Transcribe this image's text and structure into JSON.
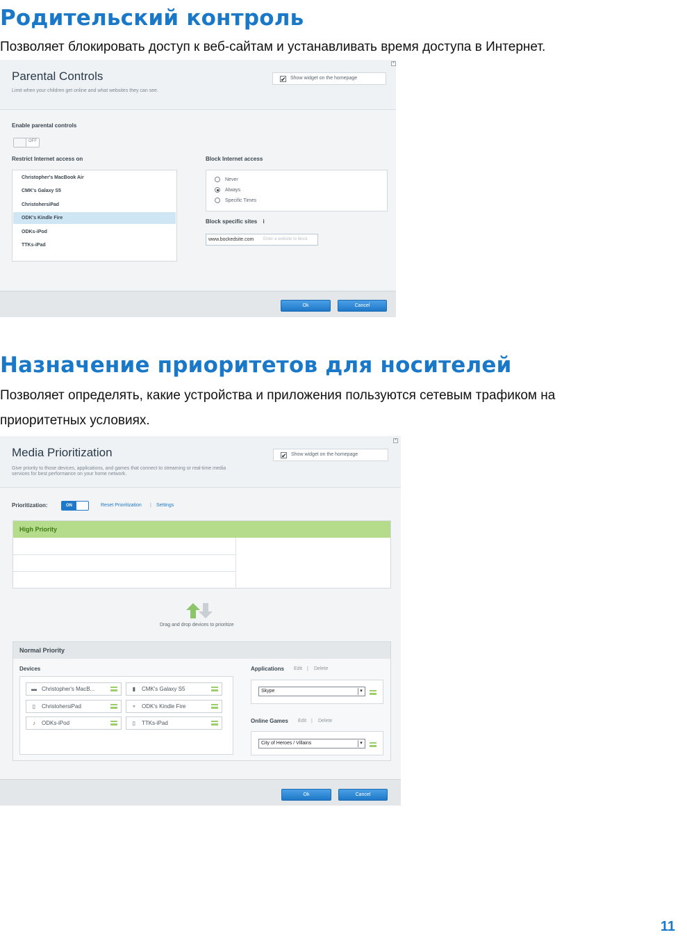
{
  "section1": {
    "heading": "Родительский контроль",
    "description": "Позволяет блокировать доступ к веб-сайтам и устанавливать время доступа в Интернет."
  },
  "parental": {
    "title": "Parental Controls",
    "subtitle": "Limit when your children get online and what websites they can see.",
    "close": "×",
    "widget_label": "Show widget on the homepage",
    "widget_checkmark": "✔",
    "enable_label": "Enable parental controls",
    "toggle_state": "OFF",
    "restrict_label": "Restrict Internet access on",
    "devices": [
      "Christopher's MacBook Air",
      "CMK's Galaxy S5",
      "ChristohersiPad",
      "ODK's Kindle Fire",
      "ODKs-iPod",
      "TTKs-iPad"
    ],
    "selected_device_index": 3,
    "block_label": "Block Internet access",
    "block_options": [
      "Never",
      "Always",
      "Specific Times"
    ],
    "block_selected": "Always",
    "sites_label": "Block specific sites",
    "sites_info": "i",
    "site_value": "www.bockedsite.com",
    "site_placeholder": "Enter a website to block",
    "ok_label": "Ok",
    "cancel_label": "Cancel"
  },
  "section2": {
    "heading": "Назначение приоритетов для носителей",
    "description_line1": "Позволяет определять, какие устройства и приложения пользуются сетевым трафиком на",
    "description_line2": "приоритетных условиях."
  },
  "media": {
    "title": "Media Prioritization",
    "subtitle_line1": "Give priority to those devices, applications, and games that connect to streaming or real-time media",
    "subtitle_line2": "services for best performance on your home network.",
    "close": "×",
    "widget_label": "Show widget on the homepage",
    "widget_checkmark": "✔",
    "prioritization_label": "Prioritization:",
    "toggle_state": "ON",
    "reset_link": "Reset Prioritization",
    "separator": "|",
    "settings_link": "Settings",
    "high_priority_label": "High Priority",
    "drag_hint": "Drag and drop devices to prioritize",
    "normal_priority_label": "Normal Priority",
    "devices_label": "Devices",
    "devices": [
      {
        "name": "Christopher's MacB...",
        "icon": "laptop-icon",
        "glyph": "▬"
      },
      {
        "name": "CMK's Galaxy S5",
        "icon": "phone-icon",
        "glyph": "▮"
      },
      {
        "name": "ChristohersiPad",
        "icon": "tablet-icon",
        "glyph": "▯"
      },
      {
        "name": "ODK's Kindle Fire",
        "icon": "kindle-icon",
        "glyph": "⚬"
      },
      {
        "name": "ODKs-iPod",
        "icon": "ipod-icon",
        "glyph": "♪"
      },
      {
        "name": "TTKs-iPad",
        "icon": "tablet-icon",
        "glyph": "▯"
      }
    ],
    "applications_label": "Applications",
    "edit_link": "Edit",
    "delete_link": "Delete",
    "application_value": "Skype",
    "games_label": "Online Games",
    "game_value": "City of Heroes / Villains",
    "dropdown_arrow": "▾",
    "ok_label": "Ok",
    "cancel_label": "Cancel"
  },
  "page_number": "11",
  "colors": {
    "heading_blue": "#1a78c8",
    "high_priority_green": "#b4dc8a",
    "button_blue": "#1f78c8"
  }
}
